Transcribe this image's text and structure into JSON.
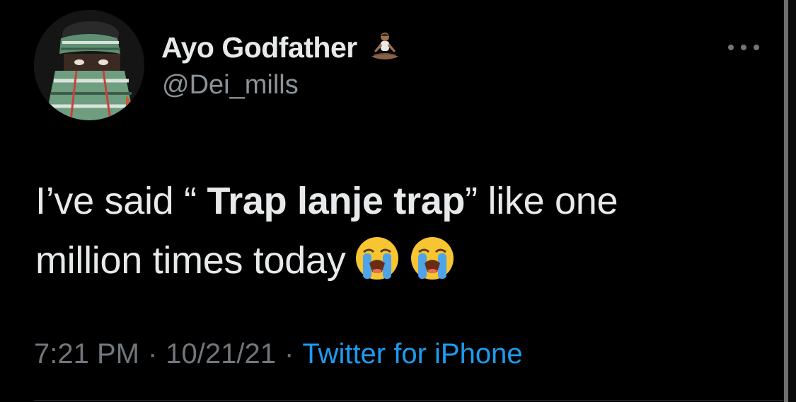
{
  "user": {
    "display_name": "Ayo Godfather",
    "name_emoji": "person-in-lotus-position-icon",
    "handle": "@Dei_mills"
  },
  "tweet": {
    "text_part1": "I’ve said “ ",
    "text_bold": "Trap lanje trap",
    "text_part2": "” like one",
    "text_line2": "million times today",
    "emojis": [
      "loudly-crying-face-icon",
      "loudly-crying-face-icon"
    ]
  },
  "meta": {
    "time": "7:21 PM",
    "separator": "·",
    "date": "10/21/21",
    "source": "Twitter for iPhone"
  },
  "colors": {
    "background": "#000000",
    "primary_text": "#e7e9ea",
    "secondary_text": "#71767b",
    "link": "#1d9bf0"
  }
}
